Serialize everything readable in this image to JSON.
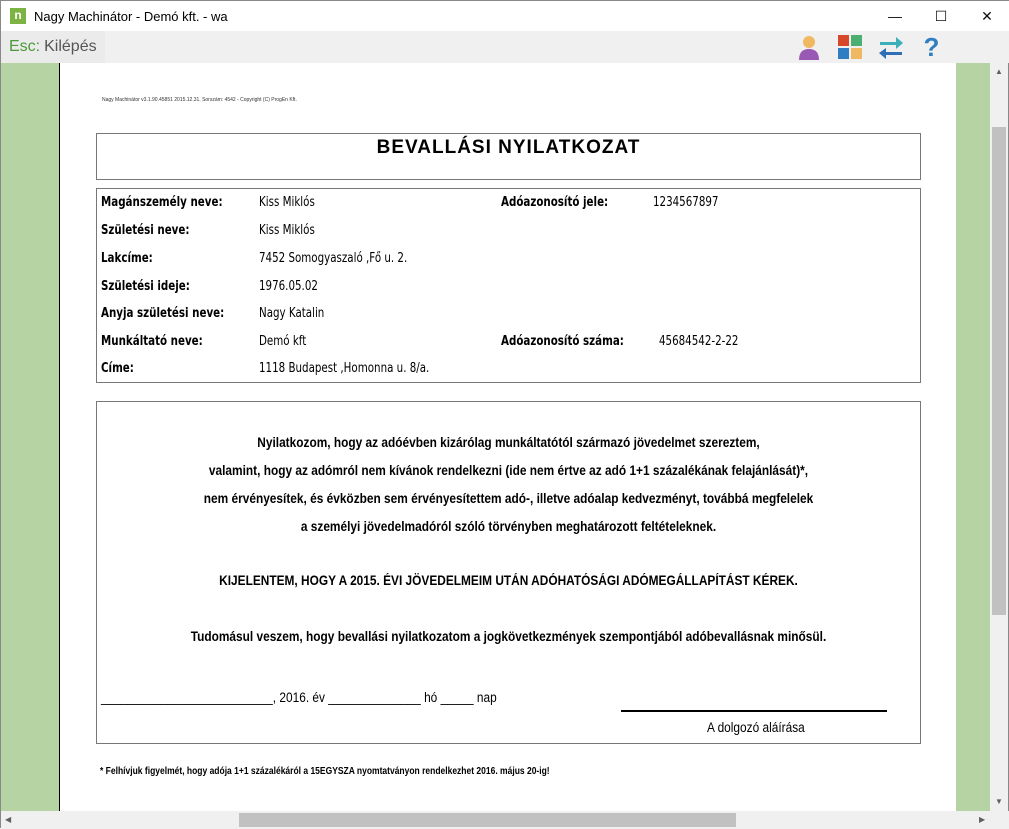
{
  "window": {
    "title": "Nagy Machinátor - Demó kft. - wa",
    "app_icon": "n",
    "controls": [
      "minimize",
      "maximize",
      "close"
    ]
  },
  "toolbar": {
    "esc_key": "Esc:",
    "esc_label": "Kilépés",
    "icons": [
      "user-icon",
      "tiles-icon",
      "swap-arrows-icon",
      "help-icon"
    ]
  },
  "document": {
    "version_line": "Nagy Machinátor v3.1.90.45851 2015.12.31. Sorszám: 4542 - Copyright (C) ProgEn Kft.",
    "title": "BEVALLÁSI NYILATKOZAT",
    "fields": [
      {
        "label": "Magánszemély neve:",
        "value": "Kiss Miklós"
      },
      {
        "label": "Születési neve:",
        "value": "Kiss Miklós"
      },
      {
        "label": "Lakcíme:",
        "value": "7452 Somogyaszaló ,Fő u. 2."
      },
      {
        "label": "Születési ideje:",
        "value": "1976.05.02"
      },
      {
        "label": "Anyja születési neve:",
        "value": "Nagy Katalin"
      },
      {
        "label": "Munkáltató neve:",
        "value": "Demó kft"
      },
      {
        "label": "Címe:",
        "value": "1118 Budapest ,Homonna u. 8/a."
      }
    ],
    "right_fields": [
      {
        "label": "Adóazonosító jele:",
        "value": "1234567897"
      },
      {
        "label": "Adóazonosító száma:",
        "value": "45684542-2-22"
      }
    ],
    "declaration": [
      "Nyilatkozom, hogy az adóévben kizárólag munkáltatótól származó jövedelmet szereztem,",
      "valamint, hogy az adómról nem kívánok rendelkezni (ide nem értve az adó 1+1 százalékának felajánlását)*,",
      "nem érvényesítek, és évközben sem érvényesítettem adó-, illetve adóalap kedvezményt, továbbá megfelelek",
      "a személyi jövedelmadóról szóló törvényben meghatározott feltételeknek."
    ],
    "statement": "KIJELENTEM, HOGY A 2015. ÉVI JÖVEDELMEIM UTÁN ADÓHATÓSÁGI ADÓMEGÁLLAPÍTÁST KÉREK.",
    "acknowledgement": "Tudomásul veszem, hogy bevallási nyilatkozatom a jogkövetkezmények szempontjából adóbevallásnak minősül.",
    "date_line": "__________________________, 2016. év ______________ hó _____ nap",
    "signature_label": "A dolgozó aláírása",
    "footnote": "* Felhívjuk figyelmét, hogy adója 1+1 százalékáról a 15EGYSZA nyomtatványon rendelkezhet 2016. május 20-ig!"
  }
}
